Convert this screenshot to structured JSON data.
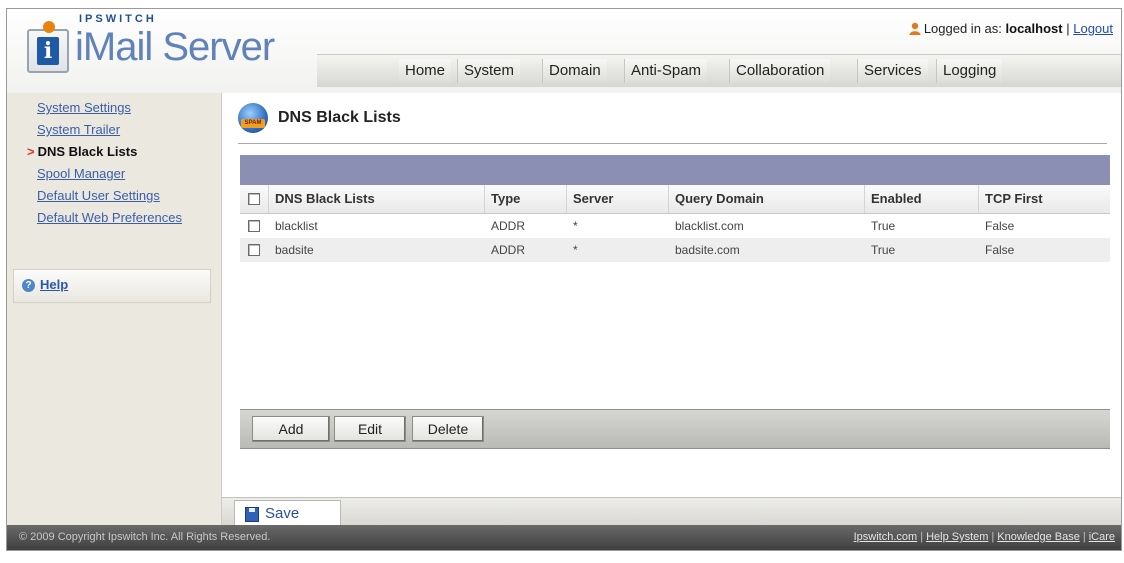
{
  "app": {
    "brand": "IPSWITCH",
    "product": "iMail Server"
  },
  "user": {
    "prefix": "Logged in as:",
    "name": "localhost",
    "separator": "|",
    "logout": "Logout"
  },
  "nav": {
    "items": [
      "Home",
      "System",
      "Domain",
      "Anti-Spam",
      "Collaboration",
      "Services",
      "Logging"
    ]
  },
  "sidebar": {
    "items": [
      {
        "label": "System Settings",
        "active": false
      },
      {
        "label": "System Trailer",
        "active": false
      },
      {
        "label": "DNS Black Lists",
        "active": true
      },
      {
        "label": "Spool Manager",
        "active": false
      },
      {
        "label": "Default User Settings",
        "active": false
      },
      {
        "label": "Default Web Preferences",
        "active": false
      }
    ],
    "help": "Help"
  },
  "page": {
    "title": "DNS Black Lists",
    "icon_label": "SPAM"
  },
  "table": {
    "columns": [
      "DNS Black Lists",
      "Type",
      "Server",
      "Query Domain",
      "Enabled",
      "TCP First"
    ],
    "rows": [
      {
        "name": "blacklist",
        "type": "ADDR",
        "server": "*",
        "query_domain": "blacklist.com",
        "enabled": "True",
        "tcp_first": "False"
      },
      {
        "name": "badsite",
        "type": "ADDR",
        "server": "*",
        "query_domain": "badsite.com",
        "enabled": "True",
        "tcp_first": "False"
      }
    ]
  },
  "toolbar": {
    "add": "Add",
    "edit": "Edit",
    "delete": "Delete"
  },
  "savebar": {
    "save": "Save"
  },
  "footer": {
    "copyright": "© 2009 Copyright Ipswitch Inc. All Rights Reserved.",
    "links": [
      "Ipswitch.com",
      "Help System",
      "Knowledge Base",
      "iCare"
    ]
  },
  "colors": {
    "accent_band": "#8c8fb4",
    "link": "#3a5ea8",
    "active_arrow": "#d83a1f"
  }
}
